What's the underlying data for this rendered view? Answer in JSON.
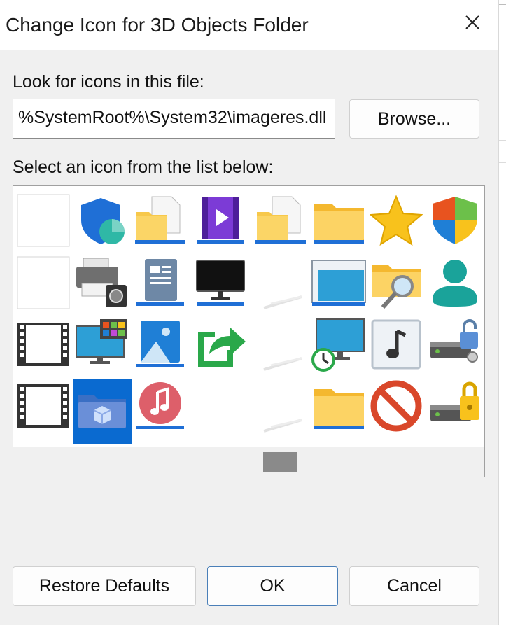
{
  "window": {
    "title": "Change Icon for 3D Objects Folder",
    "close_icon": "close-icon"
  },
  "file_section": {
    "label": "Look for icons in this file:",
    "path_value": "%SystemRoot%\\System32\\imageres.dll",
    "browse_label": "Browse..."
  },
  "icon_section": {
    "label": "Select an icon from the list below:"
  },
  "icons": [
    [
      "blank-icon",
      "security-shield-icon",
      "folder-document-icon",
      "video-library-icon",
      "folder-document-icon",
      "folder-icon",
      "favorites-star-icon",
      "windows-security-shield-icon"
    ],
    [
      "blank-icon",
      "printer-camera-icon",
      "document-icon",
      "monitor-icon",
      "shortcut-lines-icon",
      "window-icon",
      "folder-search-icon",
      "user-icon"
    ],
    [
      "film-strip-icon",
      "display-settings-icon",
      "pictures-icon",
      "share-arrow-icon",
      "shortcut-lines-icon",
      "monitor-history-icon",
      "music-note-icon",
      "drive-unlocked-icon"
    ],
    [
      "film-strip-icon",
      "3d-objects-folder-icon",
      "music-icon",
      "empty-icon",
      "shortcut-lines-icon",
      "folder-icon",
      "blocked-icon",
      "drive-locked-icon"
    ]
  ],
  "selected_icon": {
    "row": 4,
    "column": 2
  },
  "buttons": {
    "restore": "Restore Defaults",
    "ok": "OK",
    "cancel": "Cancel"
  },
  "colors": {
    "selection": "#0a6ad0",
    "folder": "#f7c84a",
    "accent": "#0078d4"
  }
}
